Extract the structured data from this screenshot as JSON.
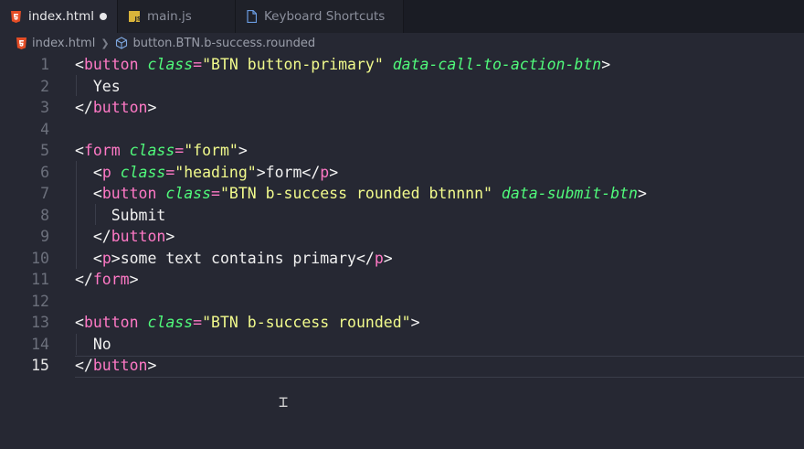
{
  "tabs": [
    {
      "label": "index.html",
      "icon": "html5-icon",
      "active": true,
      "unsaved": true
    },
    {
      "label": "main.js",
      "icon": "js-icon",
      "active": false
    },
    {
      "label": "Keyboard Shortcuts",
      "icon": "file-icon",
      "active": false
    }
  ],
  "breadcrumb": {
    "file": "index.html",
    "element": "button.BTN.b-success.rounded"
  },
  "editor": {
    "current_line": "15",
    "lines": [
      {
        "num": "1",
        "code": "<button class=\"BTN button-primary\" data-call-to-action-btn>"
      },
      {
        "num": "2",
        "code": "  Yes"
      },
      {
        "num": "3",
        "code": "</button>"
      },
      {
        "num": "4",
        "code": ""
      },
      {
        "num": "5",
        "code": "<form class=\"form\">"
      },
      {
        "num": "6",
        "code": "  <p class=\"heading\">form</p>"
      },
      {
        "num": "7",
        "code": "  <button class=\"BTN b-success rounded btnnnn\" data-submit-btn>"
      },
      {
        "num": "8",
        "code": "    Submit"
      },
      {
        "num": "9",
        "code": "  </button>"
      },
      {
        "num": "10",
        "code": "  <p>some text contains primary</p>"
      },
      {
        "num": "11",
        "code": "</form>"
      },
      {
        "num": "12",
        "code": ""
      },
      {
        "num": "13",
        "code": "<button class=\"BTN b-success rounded\">"
      },
      {
        "num": "14",
        "code": "  No"
      },
      {
        "num": "15",
        "code": "</button>"
      }
    ]
  }
}
